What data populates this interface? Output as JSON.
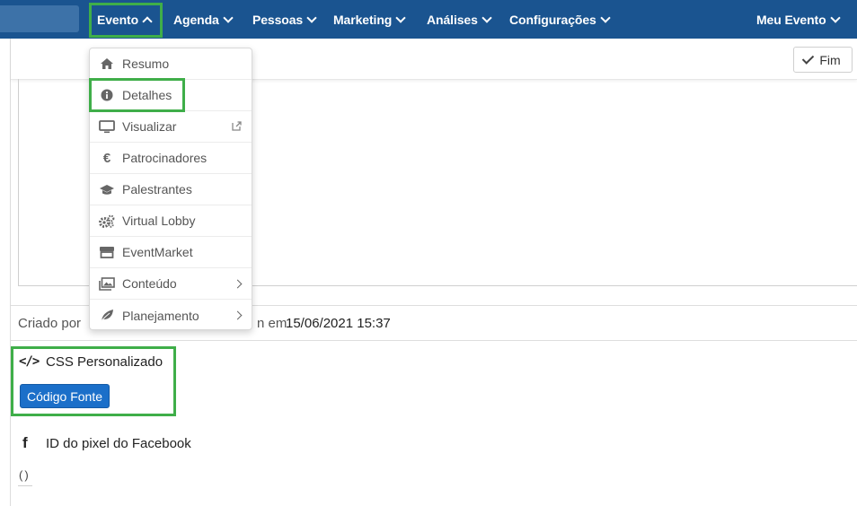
{
  "nav": {
    "items": [
      {
        "label": "Evento"
      },
      {
        "label": "Agenda"
      },
      {
        "label": "Pessoas"
      },
      {
        "label": "Marketing"
      },
      {
        "label": "Análises"
      },
      {
        "label": "Configurações"
      }
    ],
    "right_label": "Meu Evento"
  },
  "toolbar": {
    "fim_label": "Fim"
  },
  "menu": {
    "items": [
      {
        "label": "Resumo",
        "icon": "home-icon"
      },
      {
        "label": "Detalhes",
        "icon": "info-circle-icon"
      },
      {
        "label": "Visualizar",
        "icon": "monitor-icon"
      },
      {
        "label": "Patrocinadores",
        "icon": "euro-icon"
      },
      {
        "label": "Palestrantes",
        "icon": "graduation-cap-icon"
      },
      {
        "label": "Virtual Lobby",
        "icon": "cogs-icon"
      },
      {
        "label": "EventMarket",
        "icon": "store-icon"
      },
      {
        "label": "Conteúdo",
        "icon": "images-icon"
      },
      {
        "label": "Planejamento",
        "icon": "leaf-icon"
      }
    ]
  },
  "info": {
    "created_label": "Criado por",
    "created_mid": "n em",
    "created_date": "15/06/2021 15:37"
  },
  "css_section": {
    "icon": "</>",
    "title": "CSS Personalizado",
    "button_label": "Código Fonte"
  },
  "facebook": {
    "icon": "f",
    "title": "ID do pixel do Facebook",
    "value": "()"
  },
  "colors": {
    "nav_bg": "#1a5490",
    "highlight": "#3fae49",
    "primary_button": "#1b6fc9"
  }
}
